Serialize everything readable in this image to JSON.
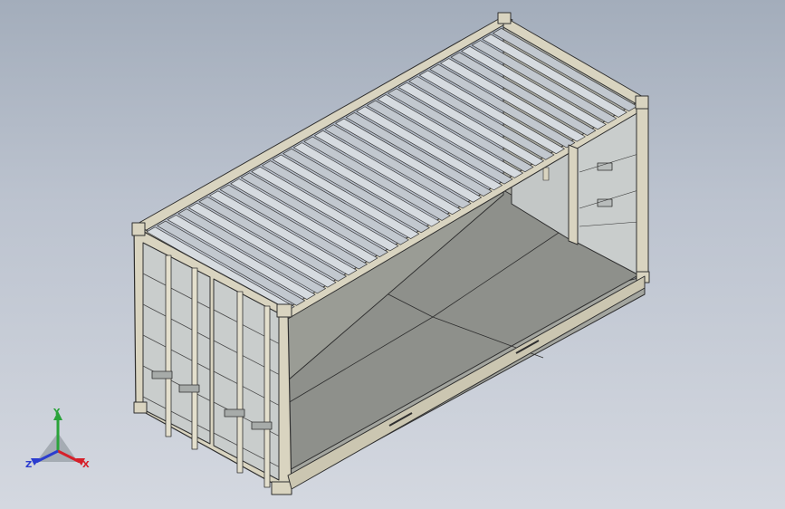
{
  "viewport": {
    "background_top": "#a3adbb",
    "background_bottom": "#d4d8e0"
  },
  "model": {
    "name": "shipping-container",
    "frame_color": "#d9d4c0",
    "panel_color": "#c9cdcc",
    "interior_color": "#8e908b",
    "floor_color": "#a3a59f",
    "outline_color": "#2f2f2f"
  },
  "triad": {
    "x_label": "X",
    "y_label": "Y",
    "z_label": "Z",
    "x_color": "#d6202a",
    "y_color": "#2aa33a",
    "z_color": "#2b3ccf"
  }
}
